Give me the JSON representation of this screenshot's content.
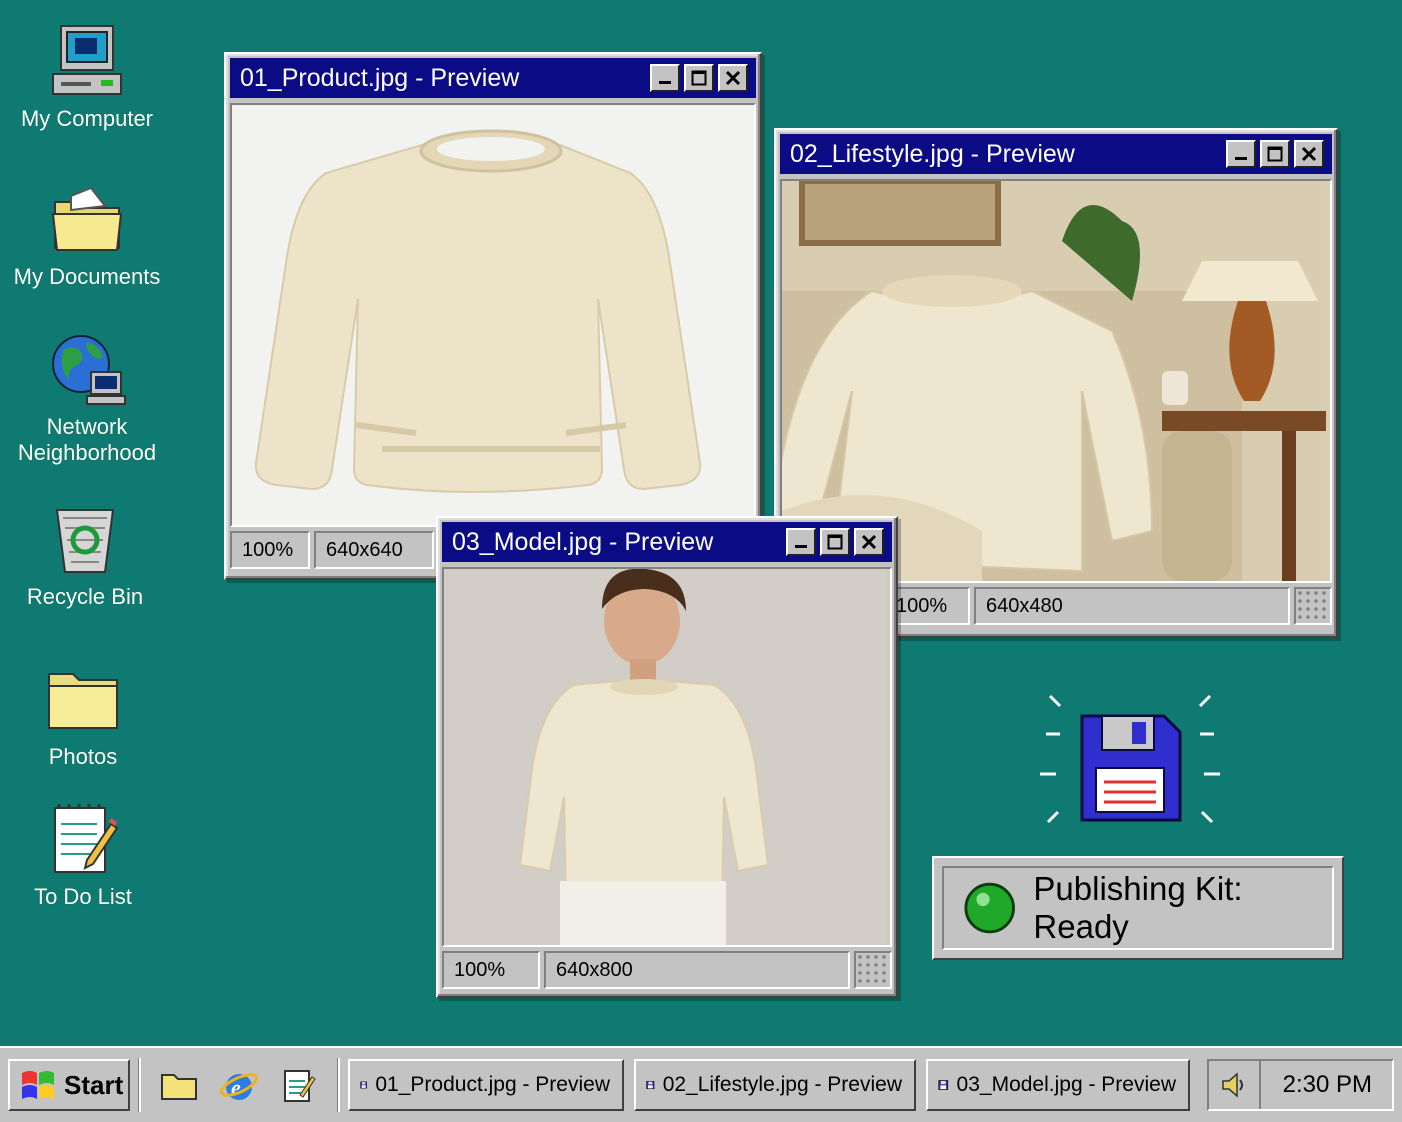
{
  "desktop": {
    "icons": [
      {
        "label": "My Computer"
      },
      {
        "label": "My Documents"
      },
      {
        "label": "Network\nNeighborhood"
      },
      {
        "label": "Recycle Bin"
      },
      {
        "label": "Photos"
      },
      {
        "label": "To Do List"
      }
    ]
  },
  "windows": {
    "product": {
      "title": "01_Product.jpg - Preview",
      "zoom": "100%",
      "size": "640x640"
    },
    "lifestyle": {
      "title": "02_Lifestyle.jpg - Preview",
      "zoom": "100%",
      "size": "640x480"
    },
    "model": {
      "title": "03_Model.jpg - Preview",
      "zoom": "100%",
      "size": "640x800"
    }
  },
  "status_panel": {
    "text": "Publishing Kit: Ready",
    "indicator_color": "#1fa82a"
  },
  "taskbar": {
    "start_label": "Start",
    "tasks": [
      {
        "label": "01_Product.jpg - Preview"
      },
      {
        "label": "02_Lifestyle.jpg - Preview"
      },
      {
        "label": "03_Model.jpg - Preview"
      }
    ],
    "clock": "2:30 PM"
  },
  "colors": {
    "desktop": "#0f7a72",
    "titlebar": "#0b0b85",
    "sweater": "#efe6d0"
  }
}
